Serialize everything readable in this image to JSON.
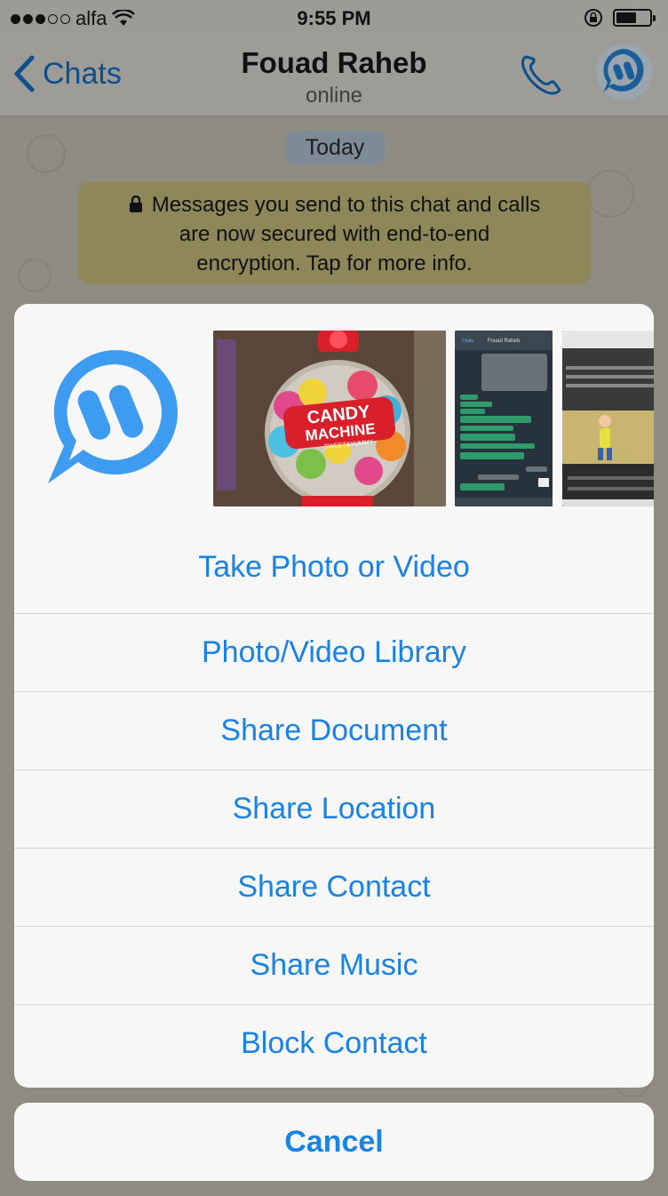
{
  "status_bar": {
    "carrier": "alfa",
    "signal_bars_filled": 3,
    "signal_bars_total": 5,
    "time": "9:55 PM",
    "battery_level": 0.6
  },
  "nav": {
    "back_label": "Chats",
    "title": "Fouad Raheb",
    "subtitle": "online"
  },
  "chat": {
    "date_label": "Today",
    "encryption_lines": [
      "Messages you send to this chat and calls",
      "are now secured with end-to-end",
      "encryption. Tap for more info."
    ]
  },
  "photo_thumbnails": {
    "candy_line1": "CANDY",
    "candy_line2": "MACHINE",
    "candy_tag": "SWEET&YUMMY",
    "chat_title": "Fouad Raheb",
    "chat_back": "Chats"
  },
  "actions": [
    {
      "label": "Take Photo or Video"
    },
    {
      "label": "Photo/Video Library"
    },
    {
      "label": "Share Document"
    },
    {
      "label": "Share Location"
    },
    {
      "label": "Share Contact"
    },
    {
      "label": "Share Music"
    },
    {
      "label": "Block Contact"
    }
  ],
  "cancel_label": "Cancel",
  "colors": {
    "accent": "#1a82e0",
    "logo_blue": "#3d9bf0"
  }
}
